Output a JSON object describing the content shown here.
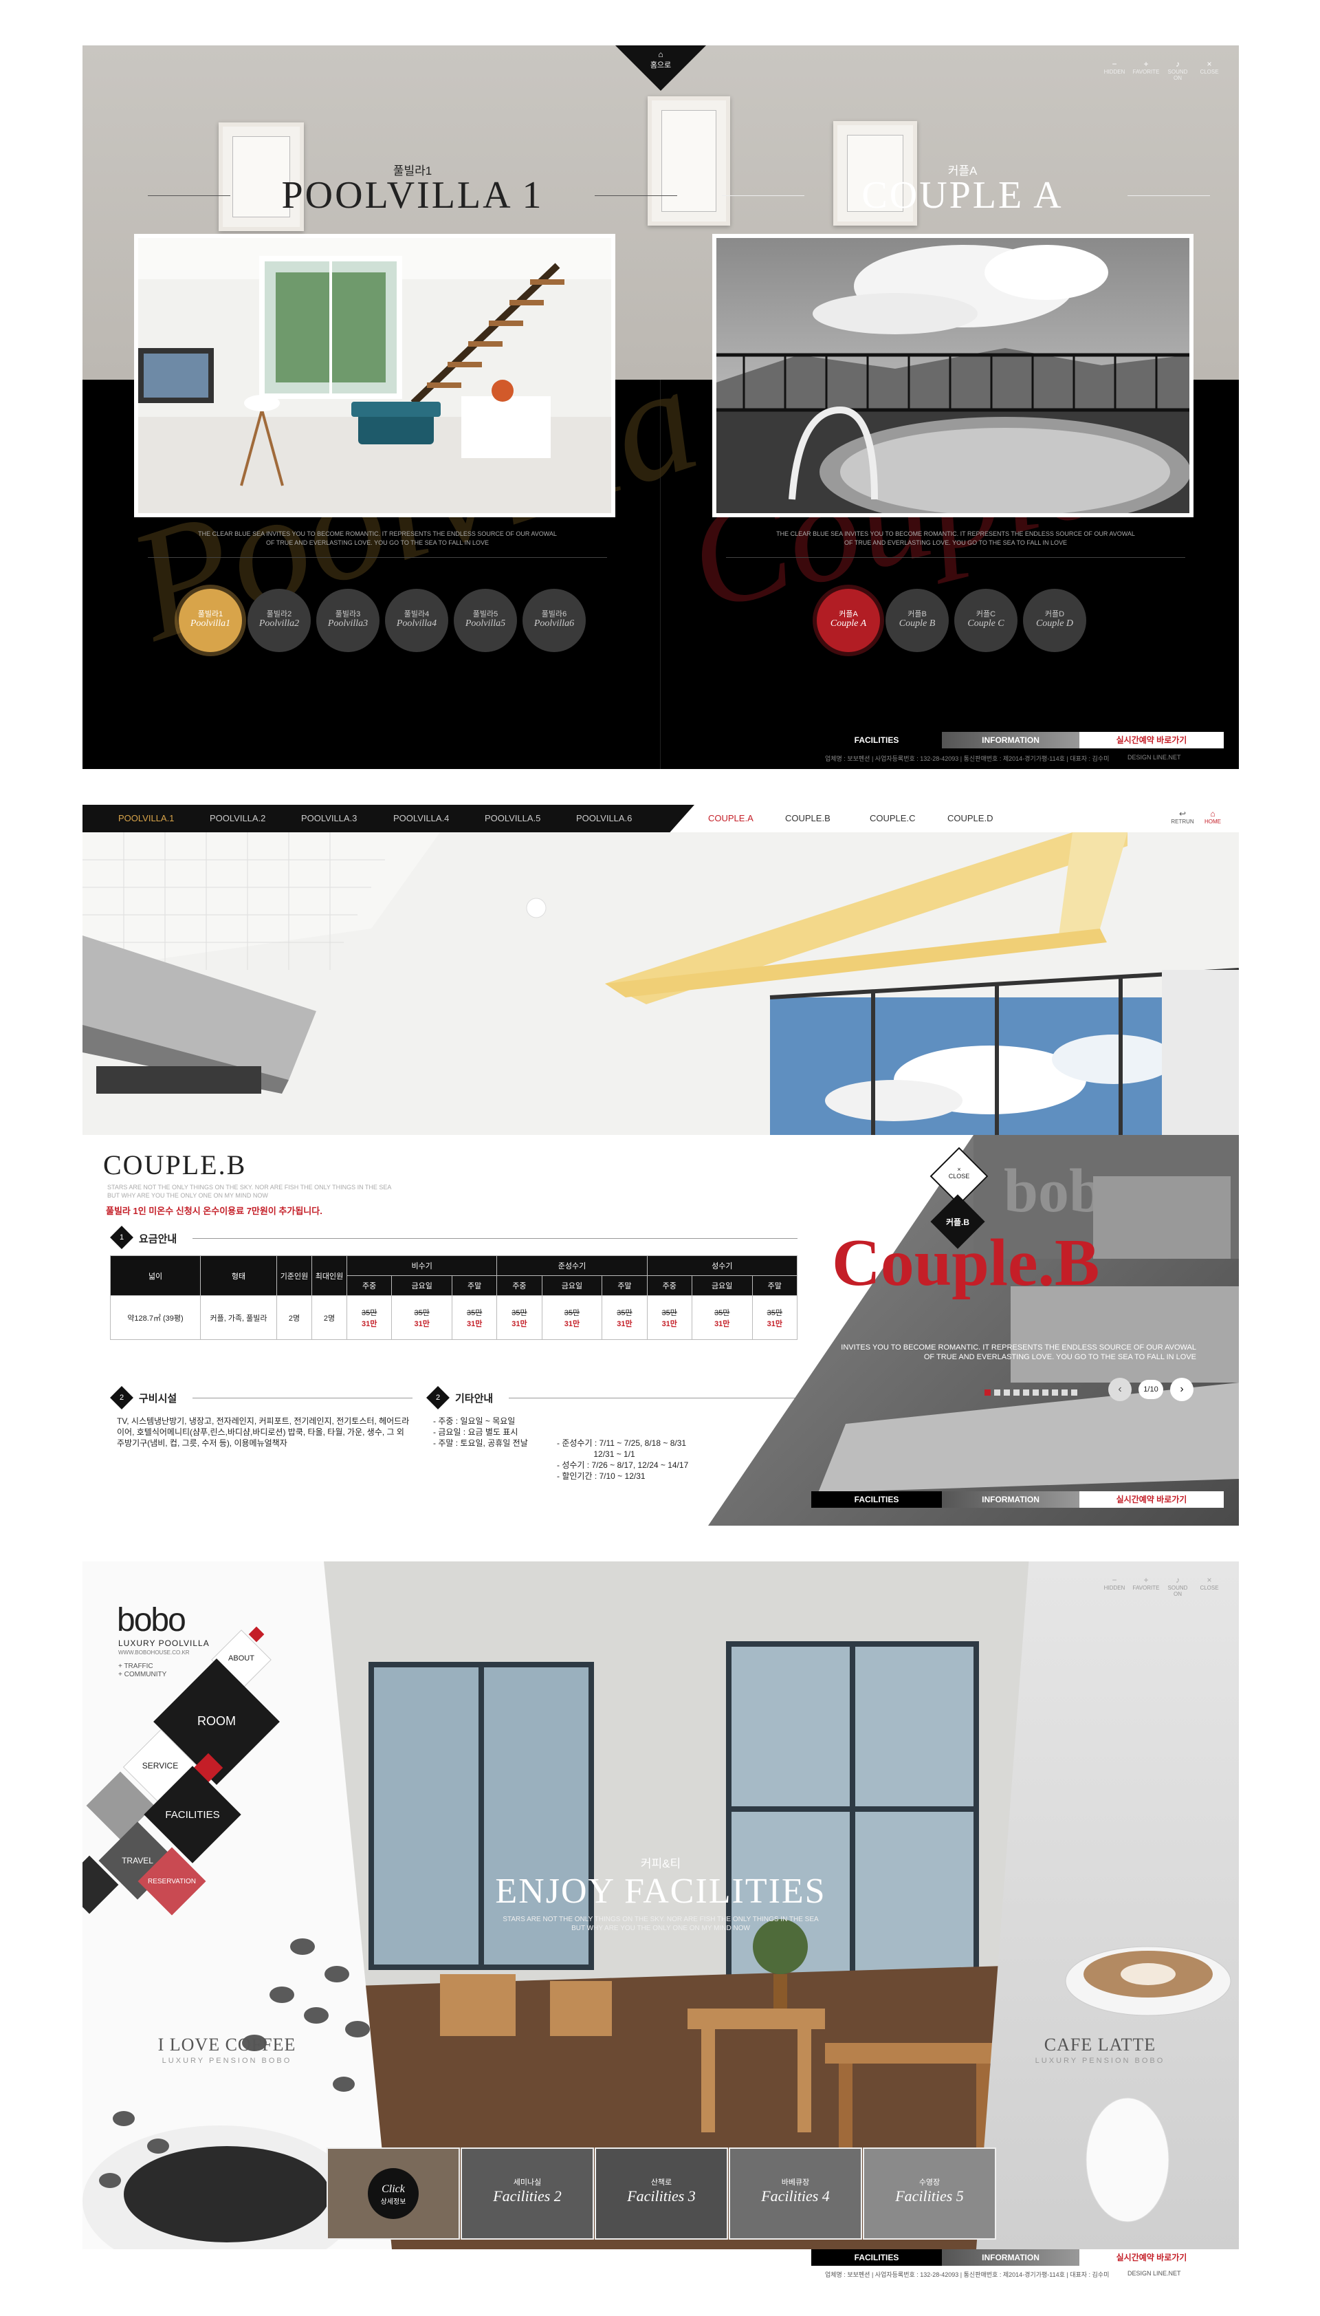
{
  "s1": {
    "home_label": "홈으로",
    "util": [
      {
        "icon": "minus-icon",
        "glyph": "−",
        "label": "HIDDEN"
      },
      {
        "icon": "plus-icon",
        "glyph": "+",
        "label": "FAVORITE"
      },
      {
        "icon": "sound-icon",
        "glyph": "♪",
        "label": "SOUND ON"
      },
      {
        "icon": "close-icon",
        "glyph": "×",
        "label": "CLOSE"
      }
    ],
    "left": {
      "ko": "풀빌라1",
      "title": "POOLVILLA 1",
      "watermark": "Poolvilla",
      "tagline1": "THE CLEAR BLUE SEA INVITES YOU TO BECOME ROMANTIC. IT REPRESENTS THE ENDLESS SOURCE OF OUR AVOWAL",
      "tagline2": "OF TRUE AND EVERLASTING LOVE. YOU GO TO THE SEA TO FALL IN LOVE",
      "rooms": [
        {
          "ko": "풀빌라1",
          "en": "Poolvilla1"
        },
        {
          "ko": "풀빌라2",
          "en": "Poolvilla2"
        },
        {
          "ko": "풀빌라3",
          "en": "Poolvilla3"
        },
        {
          "ko": "풀빌라4",
          "en": "Poolvilla4"
        },
        {
          "ko": "풀빌라5",
          "en": "Poolvilla5"
        },
        {
          "ko": "풀빌라6",
          "en": "Poolvilla6"
        }
      ]
    },
    "right": {
      "ko": "커플A",
      "title": "COUPLE A",
      "watermark": "Couple",
      "tagline1": "THE CLEAR BLUE SEA INVITES YOU TO BECOME ROMANTIC. IT REPRESENTS THE ENDLESS SOURCE OF OUR AVOWAL",
      "tagline2": "OF TRUE AND EVERLASTING LOVE. YOU GO TO THE SEA TO FALL IN LOVE",
      "rooms": [
        {
          "ko": "커플A",
          "en": "Couple A"
        },
        {
          "ko": "커플B",
          "en": "Couple B"
        },
        {
          "ko": "커플C",
          "en": "Couple C"
        },
        {
          "ko": "커플D",
          "en": "Couple D"
        }
      ]
    },
    "bottom_tabs": [
      "FACILITIES",
      "INFORMATION",
      "실시간예약 바로가기"
    ],
    "footer": "업체명 : 보보펜션  |  사업자등록번호 : 132-28-42093  |  통신판매번호 : 제2014-경기가평-114호  |  대표자 : 김수미",
    "design": "DESIGN LINE.NET"
  },
  "s2": {
    "left_nav": [
      "POOLVILLA.1",
      "POOLVILLA.2",
      "POOLVILLA.3",
      "POOLVILLA.4",
      "POOLVILLA.5",
      "POOLVILLA.6"
    ],
    "right_nav": [
      "COUPLE.A",
      "COUPLE.B",
      "COUPLE.C",
      "COUPLE.D"
    ],
    "return_label": "RETRUN",
    "home_label": "HOME",
    "room_title": "COUPLE.B",
    "sub1": "STARS ARE NOT THE ONLY THINGS ON THE SKY. NOR ARE FISH THE ONLY THINGS IN THE SEA",
    "sub2": "BUT WHY ARE YOU THE ONLY ONE ON MY MIND NOW",
    "notice": "풀빌라 1인 미온수 신청시 온수이용료 7만원이 추가됩니다.",
    "sec1": {
      "num": "1",
      "title": "요금안내"
    },
    "table": {
      "headers": [
        "넓이",
        "형태",
        "기준인원",
        "최대인원"
      ],
      "seasons": [
        "비수기",
        "준성수기",
        "성수기"
      ],
      "days": [
        "주중",
        "금요일",
        "주말"
      ],
      "row": {
        "area": "약128.7㎡ (39평)",
        "type": "커플, 가족, 풀빌라",
        "base": "2명",
        "max": "2명"
      },
      "old_price": "35만",
      "new_price": "31만"
    },
    "sec2": {
      "num": "2",
      "title": "구비시설",
      "text": "TV, 시스템냉난방기, 냉장고, 전자레인지, 커피포트, 전기레인지, 전기토스터, 헤어드라이어, 호텔식어메니티(샴푸,린스,바디샴,바디로션) 밥쿡, 타올, 타월, 가운, 생수, 그 외 주방기구(냄비, 컵, 그릇, 수저 등), 이용메뉴얼책자"
    },
    "sec3": {
      "num": "2",
      "title": "기타안내",
      "col1": [
        "- 주중 : 일요일 ~ 목요일",
        "- 금요일 : 요금 별도 표시",
        "- 주말 : 토요일, 공휴일 전날"
      ],
      "col2": [
        "- 준성수기 : 7/11 ~ 7/25, 8/18 ~ 8/31",
        "                12/31 ~ 1/1",
        "- 성수기 : 7/26 ~ 8/17, 12/24 ~ 14/17",
        "- 할인기간 : 7/10 ~ 12/31"
      ]
    },
    "close_label": "CLOSE",
    "room_badge": "커플.B",
    "brand": "bobo",
    "big_title": "Couple.B",
    "tagline1": "INVITES YOU TO BECOME ROMANTIC. IT REPRESENTS THE ENDLESS SOURCE OF OUR AVOWAL",
    "tagline2": "OF TRUE AND EVERLASTING LOVE. YOU GO TO THE SEA TO FALL IN LOVE",
    "pager": "1/10",
    "bottom_tabs": [
      "FACILITIES",
      "INFORMATION",
      "실시간예약 바로가기"
    ]
  },
  "s3": {
    "logo": "bobo",
    "logo_sub": "LUXURY POOLVILLA",
    "logo_url": "WWW.BOBOHOUSE.CO.KR",
    "quick": [
      "+ TRAFFIC",
      "+ COMMUNITY"
    ],
    "menu": {
      "about": "ABOUT",
      "room": "ROOM",
      "service": "SERVICE",
      "facilities": "FACILITIES",
      "travel": "TRAVEL",
      "reservation": "RESERVATION"
    },
    "util": [
      {
        "icon": "minus-icon",
        "glyph": "−",
        "label": "HIDDEN"
      },
      {
        "icon": "plus-icon",
        "glyph": "+",
        "label": "FAVORITE"
      },
      {
        "icon": "sound-icon",
        "glyph": "♪",
        "label": "SOUND ON"
      },
      {
        "icon": "close-icon",
        "glyph": "×",
        "label": "CLOSE"
      }
    ],
    "ko": "커피&티",
    "title": "ENJOY FACILITIES",
    "sub1": "STARS ARE NOT THE ONLY THINGS ON THE SKY. NOR ARE FISH THE ONLY THINGS IN THE SEA",
    "sub2": "BUT WHY ARE YOU THE ONLY ONE ON MY MIND NOW",
    "left_caption": "I LOVE COFFEE",
    "left_caption_sub": "LUXURY PENSION BOBO",
    "right_caption": "CAFE LATTE",
    "right_caption_sub": "LUXURY PENSION BOBO",
    "thumbs": [
      {
        "ko": "Click",
        "en": "상세정보"
      },
      {
        "ko": "세미나실",
        "en": "Facilities 2"
      },
      {
        "ko": "산책로",
        "en": "Facilities 3"
      },
      {
        "ko": "바베큐장",
        "en": "Facilities 4"
      },
      {
        "ko": "수영장",
        "en": "Facilities 5"
      }
    ],
    "bottom_tabs": [
      "FACILITIES",
      "INFORMATION",
      "실시간예약 바로가기"
    ],
    "footer": "업체명 : 보보펜션  |  사업자등록번호 : 132-28-42093  |  통신판매번호 : 제2014-경기가평-114호  |  대표자 : 김수미",
    "design": "DESIGN LINE.NET"
  },
  "colors": {
    "gold": "#d8a44a",
    "red": "#c41e27",
    "dark": "#111111"
  }
}
